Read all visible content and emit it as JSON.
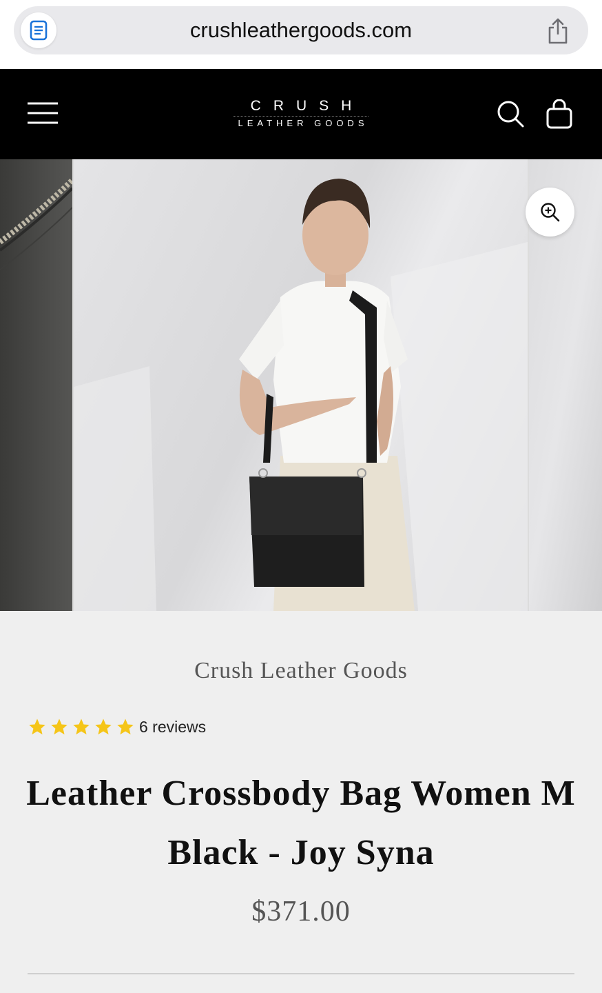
{
  "browser": {
    "url": "crushleathergoods.com",
    "reader_icon": "reader-icon",
    "share_icon": "share-icon"
  },
  "header": {
    "logo_top": "CRUSH",
    "logo_bottom": "LEATHER GOODS",
    "menu_icon": "hamburger-menu-icon",
    "search_icon": "search-icon",
    "cart_icon": "shopping-bag-icon",
    "background": "#000000"
  },
  "gallery": {
    "zoom_icon": "zoom-in-icon"
  },
  "product": {
    "vendor": "Crush Leather Goods",
    "rating_stars": 5,
    "rating_color": "#f5c518",
    "review_count": "6 reviews",
    "title": "Leather Crossbody Bag Women M Black - Joy Syna",
    "price": "$371.00"
  }
}
